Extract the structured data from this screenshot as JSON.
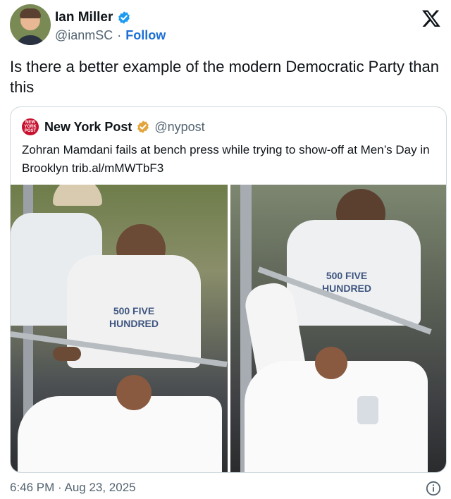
{
  "author": {
    "name": "Ian Miller",
    "handle": "@ianmSC",
    "separator": "·",
    "follow_label": "Follow",
    "verified_color": "#1d9bf0"
  },
  "tweet": {
    "text": "Is there a better example of the modern Democratic Party than this"
  },
  "quoted": {
    "logo_text": "NEW YORK POST",
    "name": "New York Post",
    "handle": "@nypost",
    "text": "Zohran Mamdani fails at bench press while trying to show-off at Men’s Day in Brooklyn trib.al/mMWTbF3",
    "badge_color": "#e2a43b",
    "brand_color": "#c8102e",
    "photos": [
      {
        "shirt_text": "500 FIVE HUNDRED"
      },
      {
        "shirt_text": "500 FIVE HUNDRED"
      }
    ]
  },
  "footer": {
    "timestamp": "6:46 PM · Aug 23, 2025"
  },
  "icons": {
    "platform": "x-logo-icon",
    "info": "info-icon",
    "verified": "verified-badge-icon"
  }
}
